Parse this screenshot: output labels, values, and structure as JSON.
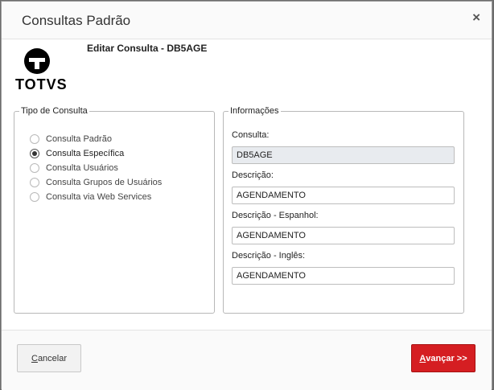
{
  "dialog": {
    "title": "Consultas Padrão",
    "close_label": "×",
    "logo_text": "TOTVS",
    "subtitle": "Editar Consulta - DB5AGE"
  },
  "tipo_consulta": {
    "legend": "Tipo de Consulta",
    "options": [
      {
        "label": "Consulta Padrão",
        "checked": false
      },
      {
        "label": "Consulta Específica",
        "checked": true
      },
      {
        "label": "Consulta Usuários",
        "checked": false
      },
      {
        "label": "Consulta Grupos de Usuários",
        "checked": false
      },
      {
        "label": "Consulta via Web Services",
        "checked": false
      }
    ]
  },
  "informacoes": {
    "legend": "Informações",
    "consulta_label": "Consulta:",
    "consulta_value": "DB5AGE",
    "descricao_label": "Descrição:",
    "descricao_value": "AGENDAMENTO",
    "descricao_es_label": "Descrição - Espanhol:",
    "descricao_es_value": "AGENDAMENTO",
    "descricao_en_label": "Descrição - Inglês:",
    "descricao_en_value": "AGENDAMENTO"
  },
  "footer": {
    "cancel_first": "C",
    "cancel_rest": "ancelar",
    "next_first": "A",
    "next_rest": "vançar >>"
  },
  "colors": {
    "primary_button": "#d51e22",
    "readonly_field": "#e8ebef"
  }
}
